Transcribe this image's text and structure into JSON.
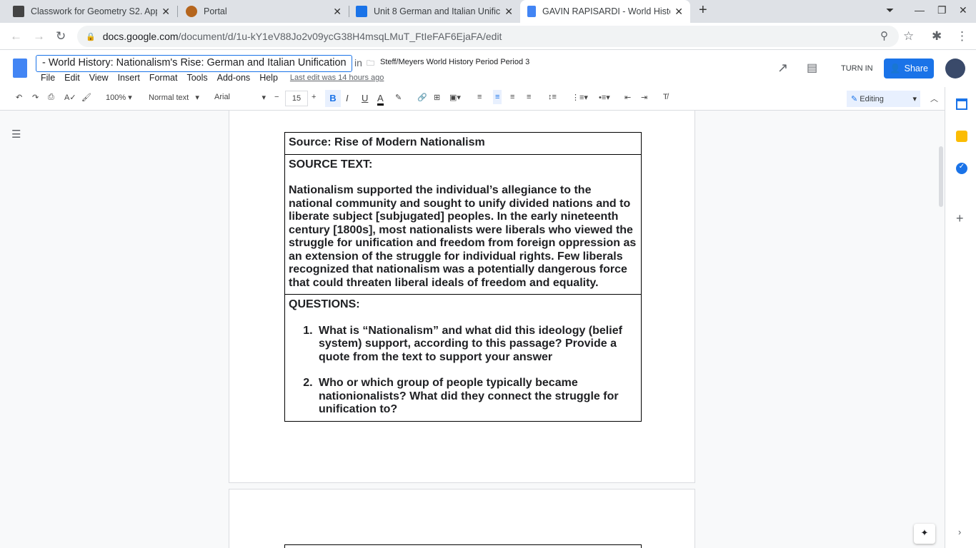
{
  "browser": {
    "tabs": [
      {
        "title": "Classwork for Geometry S2. App",
        "icon": "classroom-icon"
      },
      {
        "title": "Portal",
        "icon": "portal-icon"
      },
      {
        "title": "Unit 8 German and Italian Unific",
        "icon": "classroom-icon"
      },
      {
        "title": "GAVIN RAPISARDI - World History",
        "icon": "docs-icon"
      }
    ],
    "url_host": "docs.google.com",
    "url_path": "/document/d/1u-kY1eV88Jo2v09ycG38H4msqLMuT_FtIeFAF6EjaFA/edit"
  },
  "doc": {
    "title": "- World History: Nationalism's Rise: German and Italian Unification",
    "in": "in",
    "folder": "Steff/Meyers World History Period Period 3",
    "menu": [
      "File",
      "Edit",
      "View",
      "Insert",
      "Format",
      "Tools",
      "Add-ons",
      "Help"
    ],
    "last_edit": "Last edit was 14 hours ago",
    "turn_in": "TURN IN",
    "share": "Share"
  },
  "toolbar": {
    "zoom": "100%",
    "style": "Normal text",
    "font": "Arial",
    "size": "15",
    "mode": "Editing"
  },
  "content": {
    "source_title": "Source: Rise of Modern Nationalism",
    "source_label": "SOURCE TEXT:",
    "source_text": "Nationalism supported the individual’s allegiance to the national community and sought to unify divided nations and to liberate subject [subjugated] peoples. In the early nineteenth century [1800s], most nationalists were liberals who viewed the struggle for unification and freedom from foreign oppression as an extension of the struggle for individual rights. Few liberals recognized that nationalism was a potentially dangerous force that could threaten liberal ideals of freedom and equality.",
    "questions_label": "QUESTIONS:",
    "questions": [
      "What is “Nationalism” and what did this ideology (belief system) support, according to this passage? Provide a quote from the text to support your answer",
      "Who or which group of people typically became nationionalists? What did they connect the struggle for unification to?"
    ]
  }
}
